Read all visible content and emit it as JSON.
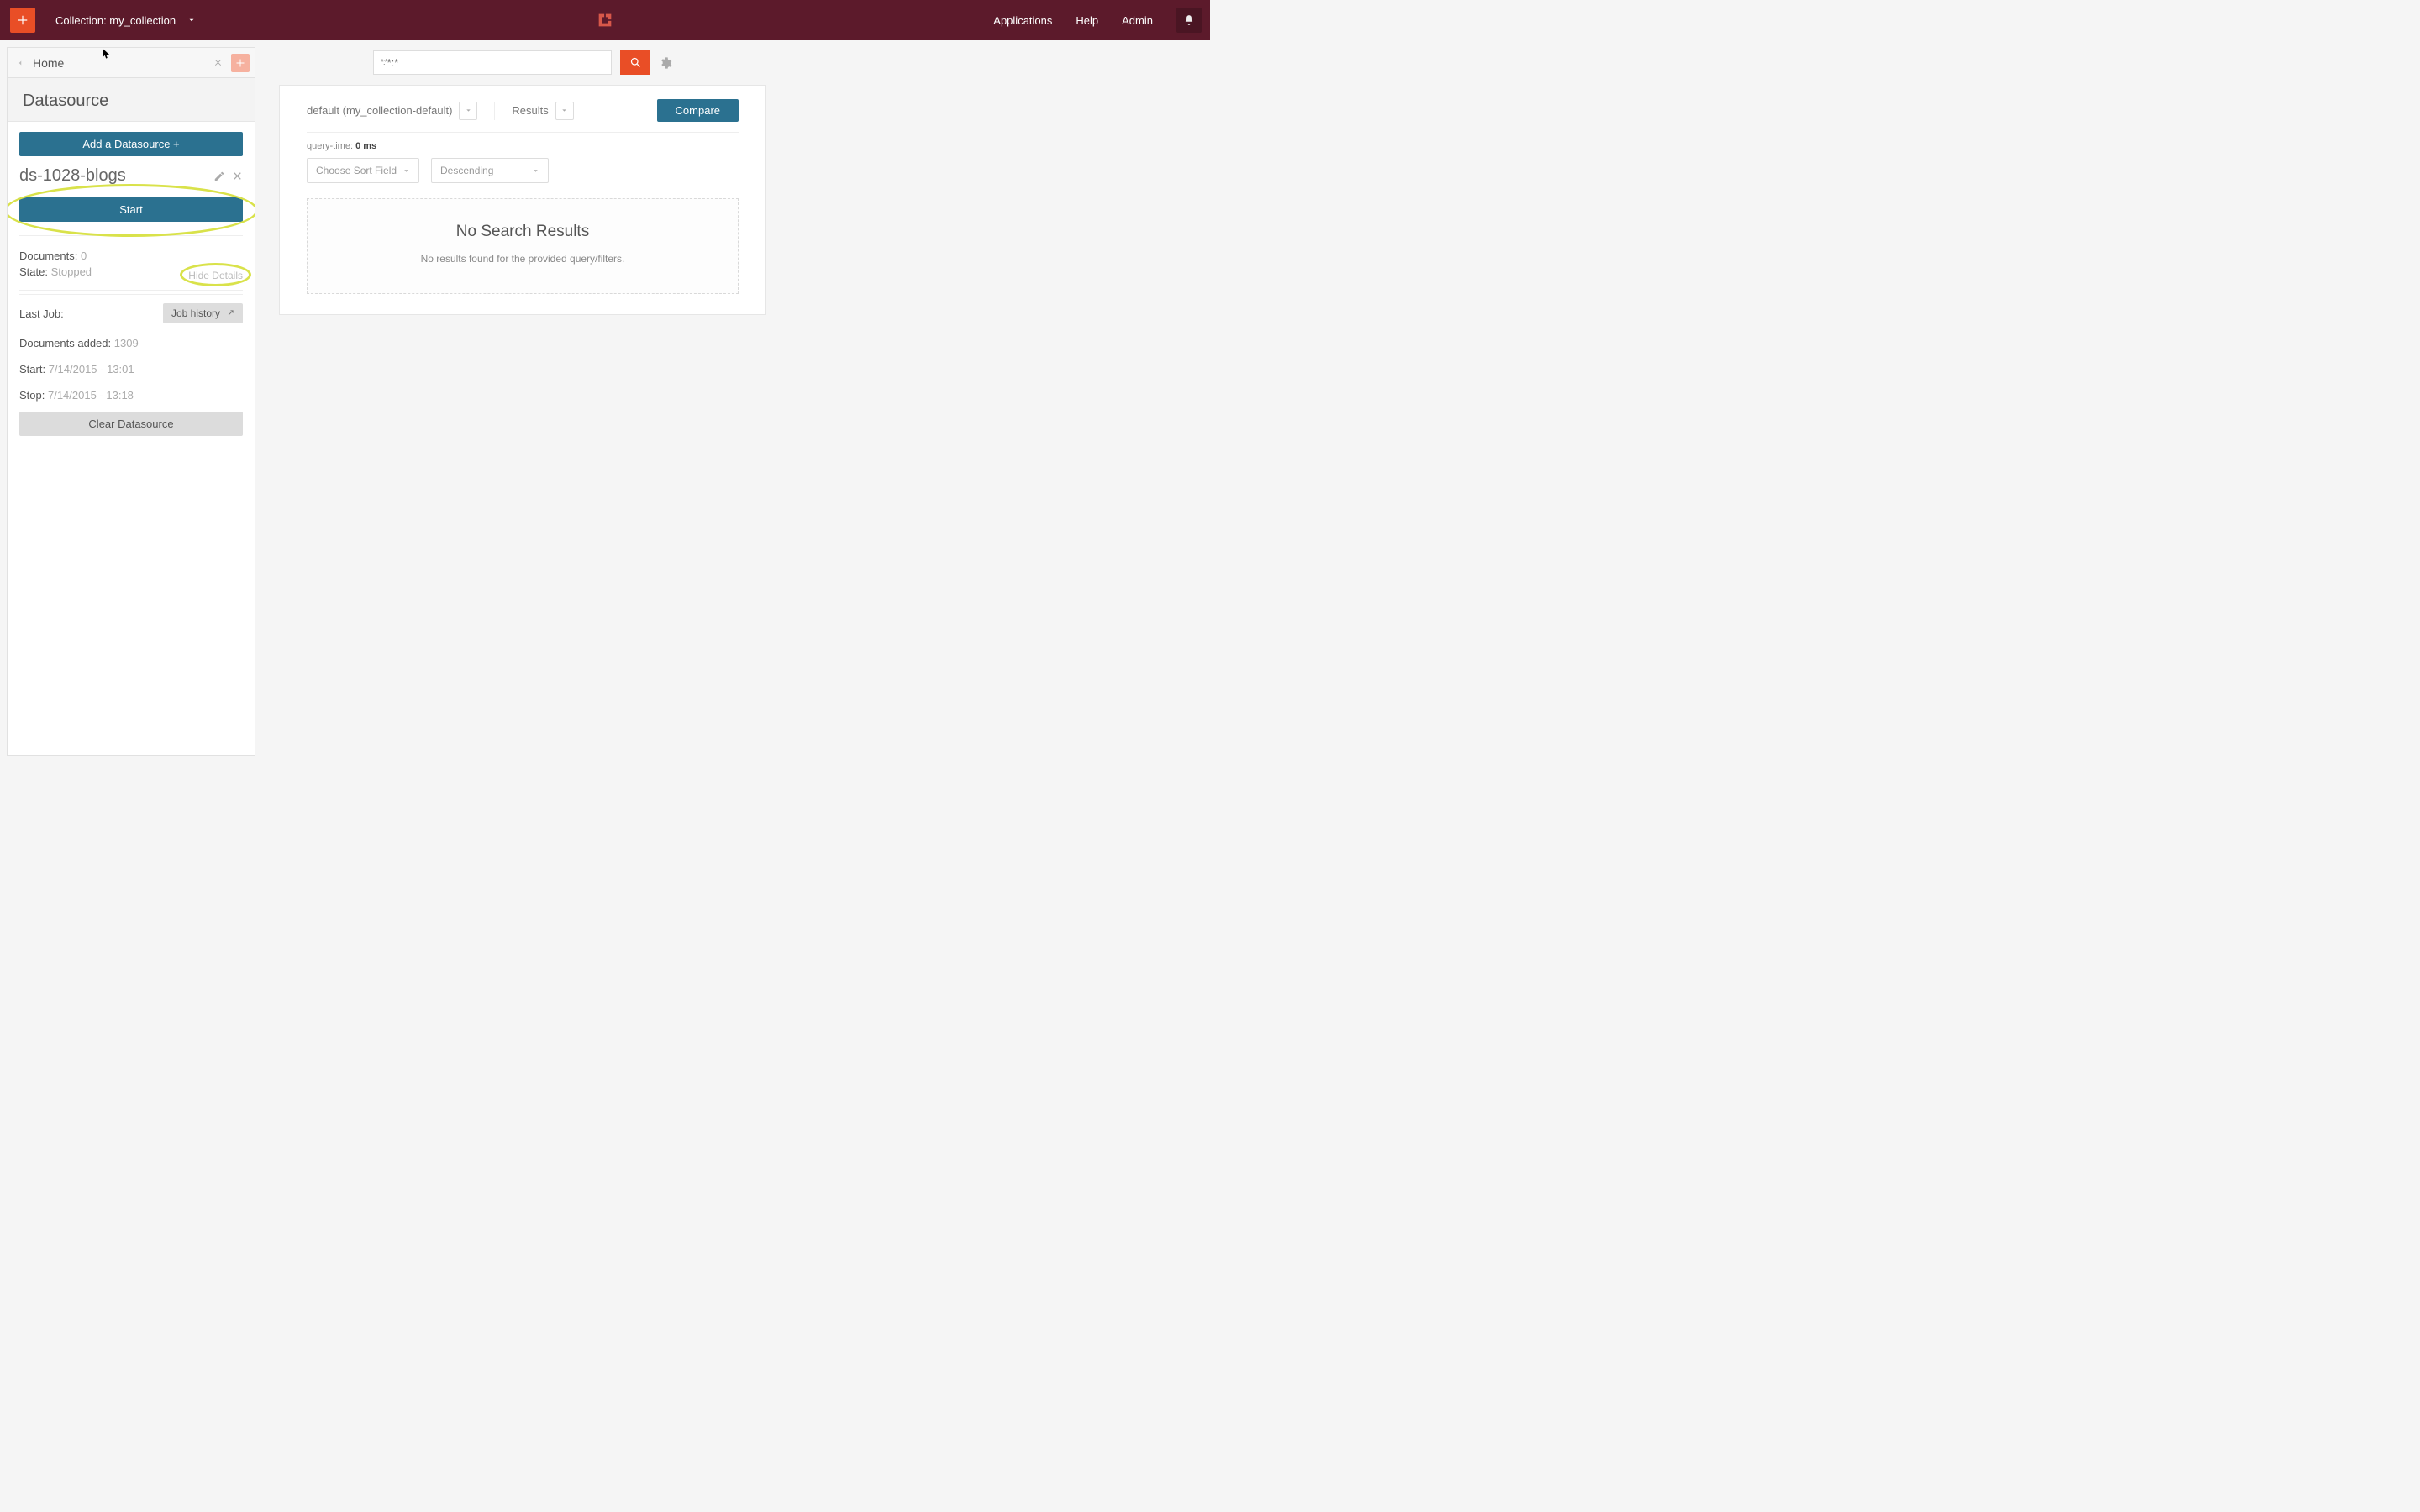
{
  "topbar": {
    "collection_label": "Collection: my_collection",
    "nav": {
      "applications": "Applications",
      "help": "Help",
      "admin": "Admin"
    }
  },
  "sidebar": {
    "tab_label": "Home",
    "heading": "Datasource",
    "add_datasource_label": "Add a Datasource +",
    "ds_name": "ds-1028-blogs",
    "start_label": "Start",
    "documents_label": "Documents:",
    "documents_value": "0",
    "state_label": "State:",
    "state_value": "Stopped",
    "hide_details_label": "Hide Details",
    "last_job_label": "Last Job:",
    "job_history_label": "Job history",
    "docs_added_label": "Documents added:",
    "docs_added_value": "1309",
    "start_ts_label": "Start:",
    "start_ts_value": "7/14/2015 - 13:01",
    "stop_ts_label": "Stop:",
    "stop_ts_value": "7/14/2015 - 13:18",
    "clear_label": "Clear Datasource"
  },
  "search": {
    "placeholder": "*:*"
  },
  "results": {
    "pipeline_label": "default (my_collection-default)",
    "results_label": "Results",
    "compare_label": "Compare",
    "query_time_label": "query-time:",
    "query_time_value": "0 ms",
    "sort_field_label": "Choose Sort Field",
    "sort_dir_label": "Descending",
    "no_results_heading": "No Search Results",
    "no_results_body": "No results found for the provided query/filters."
  }
}
